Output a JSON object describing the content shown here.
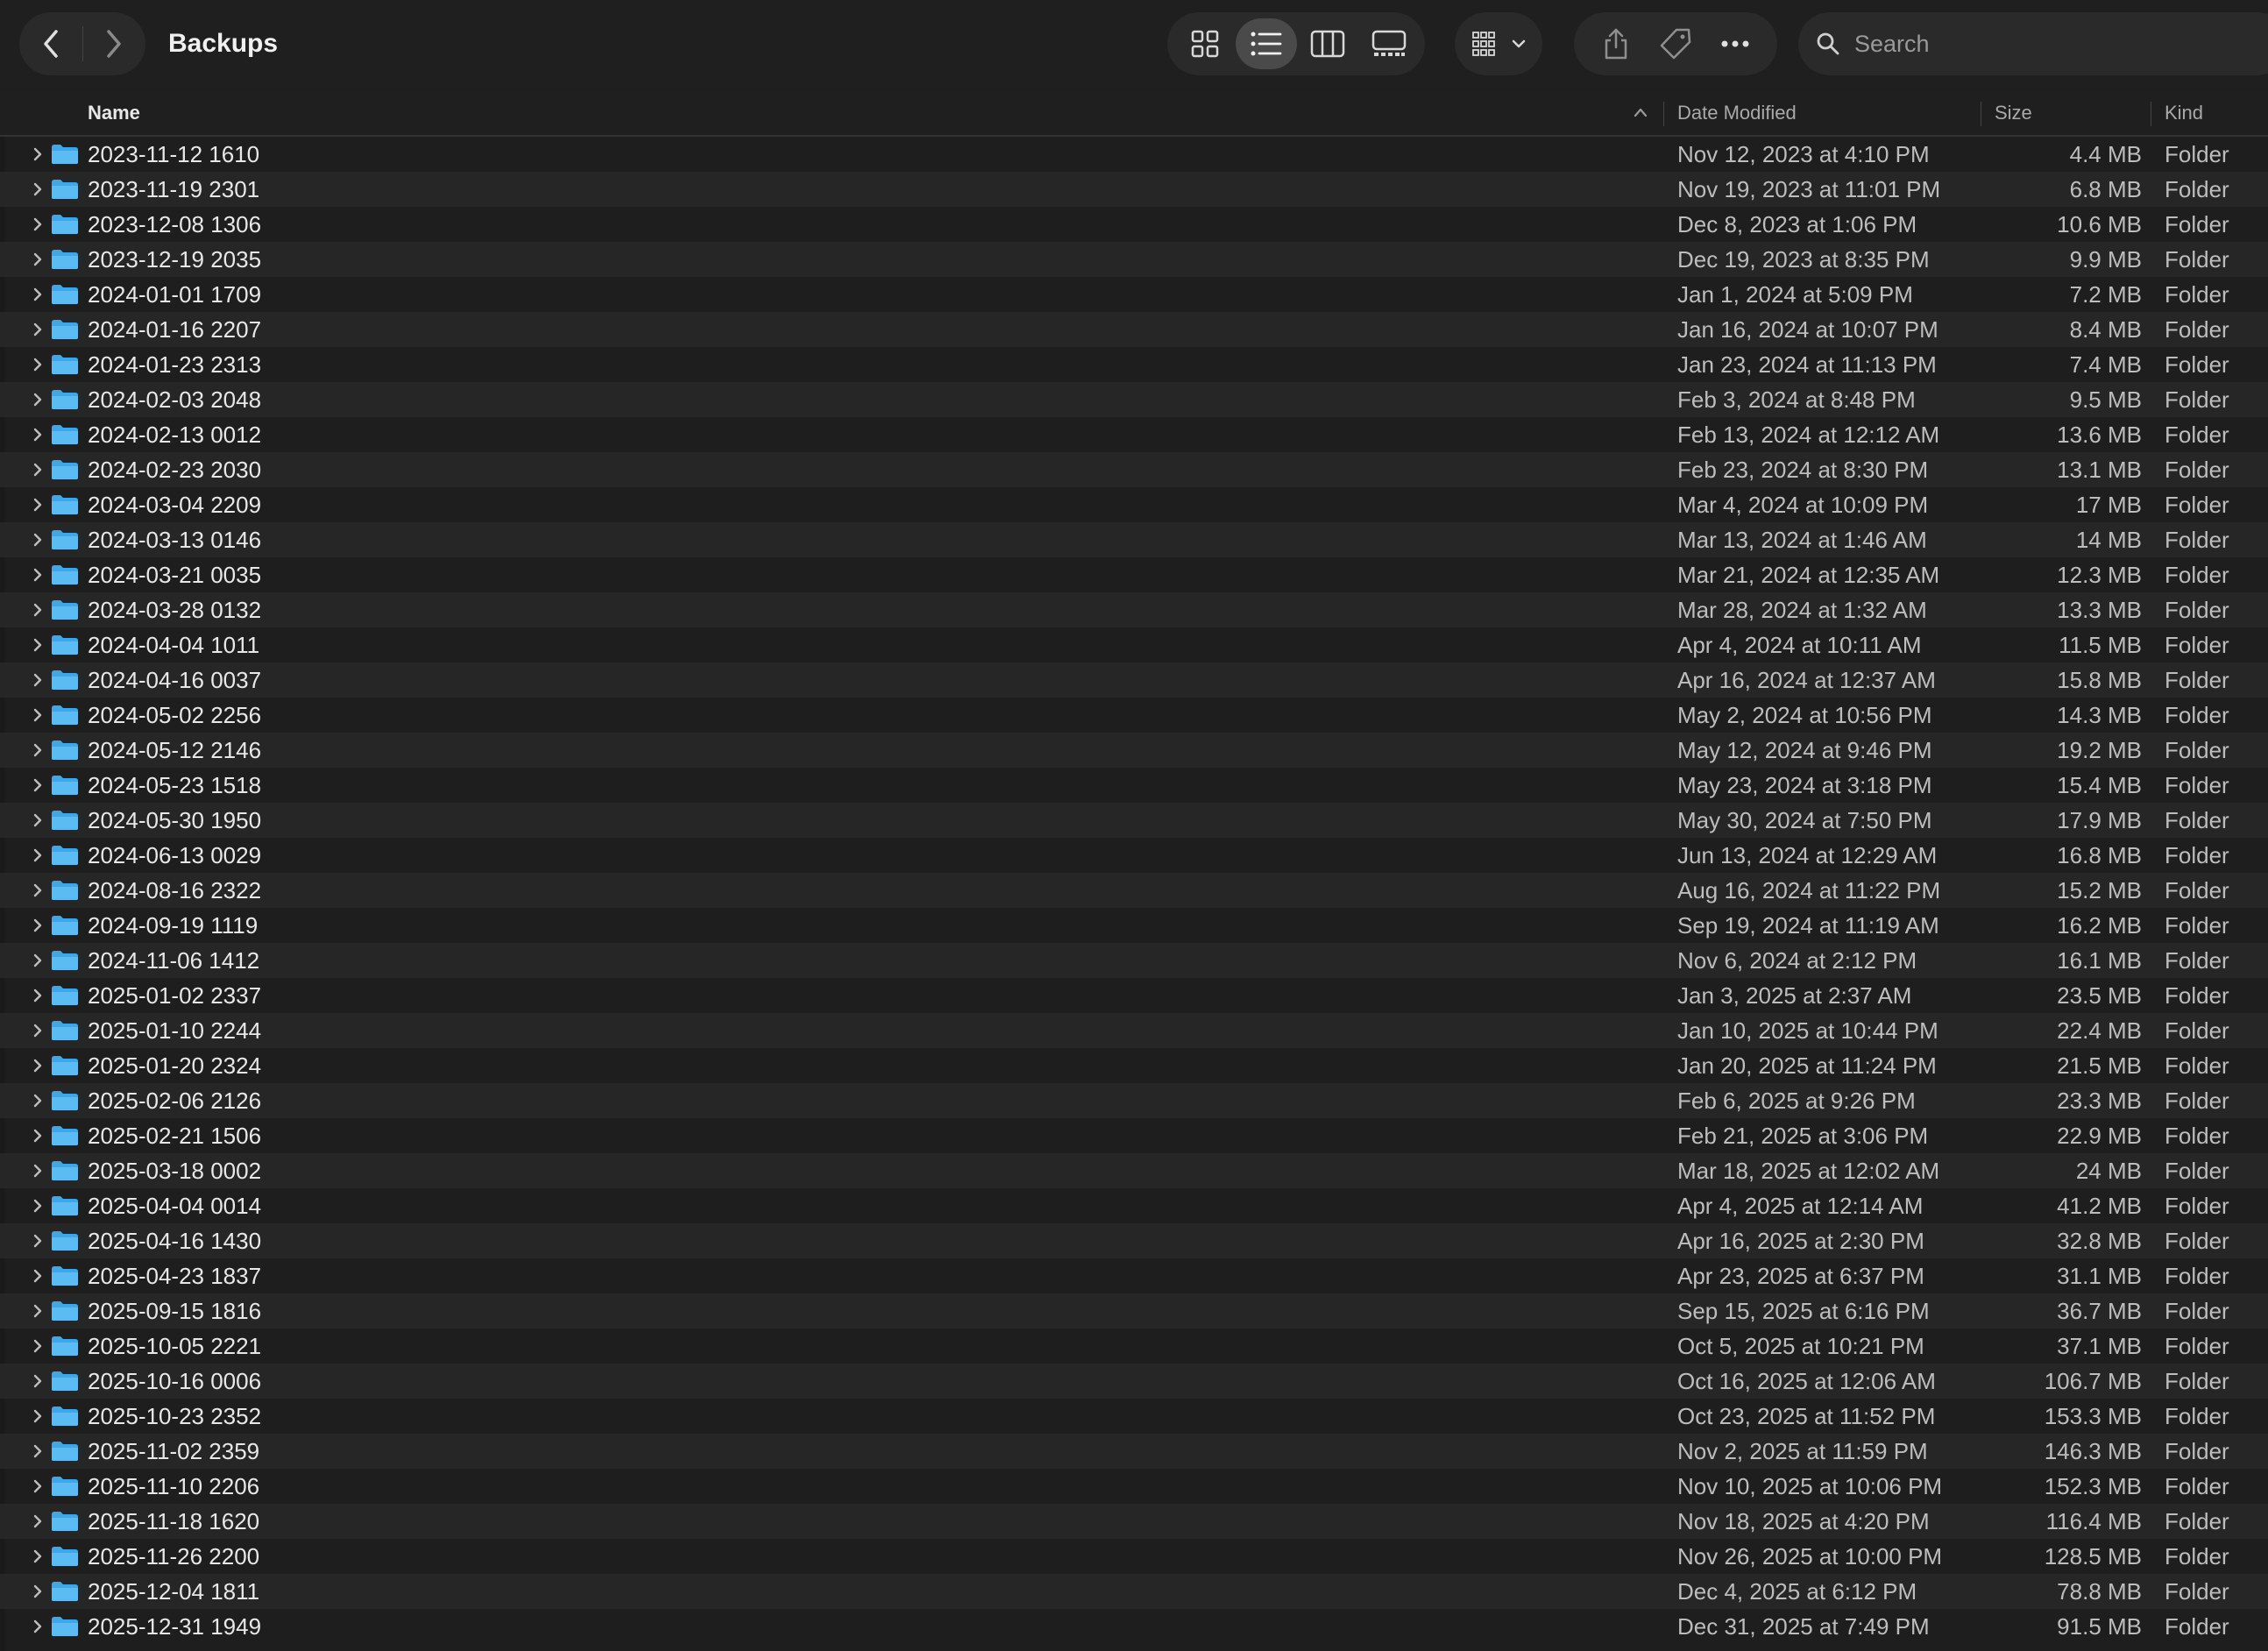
{
  "window": {
    "title": "Backups"
  },
  "toolbar": {
    "search_placeholder": "Search",
    "icons": {
      "back": "chevron-left-icon",
      "forward": "chevron-right-icon",
      "icon_view": "grid-icon",
      "list_view": "list-icon",
      "column_view": "columns-icon",
      "gallery_view": "gallery-icon",
      "group": "group-icon",
      "share": "share-icon",
      "tag": "tag-icon",
      "more": "ellipsis-icon",
      "search": "search-icon"
    },
    "active_view": "list"
  },
  "columns": {
    "name": "Name",
    "date": "Date Modified",
    "size": "Size",
    "kind": "Kind"
  },
  "colors": {
    "background": "#1e1e1e",
    "row_alt": "#262626",
    "folder": "#3ea7e8",
    "text": "#e8e8e8",
    "secondary_text": "#bdbdbd"
  },
  "rows": [
    {
      "name": "2023-11-12 1610",
      "date": "Nov 12, 2023 at 4:10 PM",
      "size": "4.4 MB",
      "kind": "Folder"
    },
    {
      "name": "2023-11-19 2301",
      "date": "Nov 19, 2023 at 11:01 PM",
      "size": "6.8 MB",
      "kind": "Folder"
    },
    {
      "name": "2023-12-08 1306",
      "date": "Dec 8, 2023 at 1:06 PM",
      "size": "10.6 MB",
      "kind": "Folder"
    },
    {
      "name": "2023-12-19 2035",
      "date": "Dec 19, 2023 at 8:35 PM",
      "size": "9.9 MB",
      "kind": "Folder"
    },
    {
      "name": "2024-01-01 1709",
      "date": "Jan 1, 2024 at 5:09 PM",
      "size": "7.2 MB",
      "kind": "Folder"
    },
    {
      "name": "2024-01-16 2207",
      "date": "Jan 16, 2024 at 10:07 PM",
      "size": "8.4 MB",
      "kind": "Folder"
    },
    {
      "name": "2024-01-23 2313",
      "date": "Jan 23, 2024 at 11:13 PM",
      "size": "7.4 MB",
      "kind": "Folder"
    },
    {
      "name": "2024-02-03 2048",
      "date": "Feb 3, 2024 at 8:48 PM",
      "size": "9.5 MB",
      "kind": "Folder"
    },
    {
      "name": "2024-02-13 0012",
      "date": "Feb 13, 2024 at 12:12 AM",
      "size": "13.6 MB",
      "kind": "Folder"
    },
    {
      "name": "2024-02-23 2030",
      "date": "Feb 23, 2024 at 8:30 PM",
      "size": "13.1 MB",
      "kind": "Folder"
    },
    {
      "name": "2024-03-04 2209",
      "date": "Mar 4, 2024 at 10:09 PM",
      "size": "17 MB",
      "kind": "Folder"
    },
    {
      "name": "2024-03-13 0146",
      "date": "Mar 13, 2024 at 1:46 AM",
      "size": "14 MB",
      "kind": "Folder"
    },
    {
      "name": "2024-03-21 0035",
      "date": "Mar 21, 2024 at 12:35 AM",
      "size": "12.3 MB",
      "kind": "Folder"
    },
    {
      "name": "2024-03-28 0132",
      "date": "Mar 28, 2024 at 1:32 AM",
      "size": "13.3 MB",
      "kind": "Folder"
    },
    {
      "name": "2024-04-04 1011",
      "date": "Apr 4, 2024 at 10:11 AM",
      "size": "11.5 MB",
      "kind": "Folder"
    },
    {
      "name": "2024-04-16 0037",
      "date": "Apr 16, 2024 at 12:37 AM",
      "size": "15.8 MB",
      "kind": "Folder"
    },
    {
      "name": "2024-05-02 2256",
      "date": "May 2, 2024 at 10:56 PM",
      "size": "14.3 MB",
      "kind": "Folder"
    },
    {
      "name": "2024-05-12 2146",
      "date": "May 12, 2024 at 9:46 PM",
      "size": "19.2 MB",
      "kind": "Folder"
    },
    {
      "name": "2024-05-23 1518",
      "date": "May 23, 2024 at 3:18 PM",
      "size": "15.4 MB",
      "kind": "Folder"
    },
    {
      "name": "2024-05-30 1950",
      "date": "May 30, 2024 at 7:50 PM",
      "size": "17.9 MB",
      "kind": "Folder"
    },
    {
      "name": "2024-06-13 0029",
      "date": "Jun 13, 2024 at 12:29 AM",
      "size": "16.8 MB",
      "kind": "Folder"
    },
    {
      "name": "2024-08-16 2322",
      "date": "Aug 16, 2024 at 11:22 PM",
      "size": "15.2 MB",
      "kind": "Folder"
    },
    {
      "name": "2024-09-19 1119",
      "date": "Sep 19, 2024 at 11:19 AM",
      "size": "16.2 MB",
      "kind": "Folder"
    },
    {
      "name": "2024-11-06 1412",
      "date": "Nov 6, 2024 at 2:12 PM",
      "size": "16.1 MB",
      "kind": "Folder"
    },
    {
      "name": "2025-01-02 2337",
      "date": "Jan 3, 2025 at 2:37 AM",
      "size": "23.5 MB",
      "kind": "Folder"
    },
    {
      "name": "2025-01-10 2244",
      "date": "Jan 10, 2025 at 10:44 PM",
      "size": "22.4 MB",
      "kind": "Folder"
    },
    {
      "name": "2025-01-20 2324",
      "date": "Jan 20, 2025 at 11:24 PM",
      "size": "21.5 MB",
      "kind": "Folder"
    },
    {
      "name": "2025-02-06 2126",
      "date": "Feb 6, 2025 at 9:26 PM",
      "size": "23.3 MB",
      "kind": "Folder"
    },
    {
      "name": "2025-02-21 1506",
      "date": "Feb 21, 2025 at 3:06 PM",
      "size": "22.9 MB",
      "kind": "Folder"
    },
    {
      "name": "2025-03-18 0002",
      "date": "Mar 18, 2025 at 12:02 AM",
      "size": "24 MB",
      "kind": "Folder"
    },
    {
      "name": "2025-04-04 0014",
      "date": "Apr 4, 2025 at 12:14 AM",
      "size": "41.2 MB",
      "kind": "Folder"
    },
    {
      "name": "2025-04-16 1430",
      "date": "Apr 16, 2025 at 2:30 PM",
      "size": "32.8 MB",
      "kind": "Folder"
    },
    {
      "name": "2025-04-23 1837",
      "date": "Apr 23, 2025 at 6:37 PM",
      "size": "31.1 MB",
      "kind": "Folder"
    },
    {
      "name": "2025-09-15 1816",
      "date": "Sep 15, 2025 at 6:16 PM",
      "size": "36.7 MB",
      "kind": "Folder"
    },
    {
      "name": "2025-10-05 2221",
      "date": "Oct 5, 2025 at 10:21 PM",
      "size": "37.1 MB",
      "kind": "Folder"
    },
    {
      "name": "2025-10-16 0006",
      "date": "Oct 16, 2025 at 12:06 AM",
      "size": "106.7 MB",
      "kind": "Folder"
    },
    {
      "name": "2025-10-23 2352",
      "date": "Oct 23, 2025 at 11:52 PM",
      "size": "153.3 MB",
      "kind": "Folder"
    },
    {
      "name": "2025-11-02 2359",
      "date": "Nov 2, 2025 at 11:59 PM",
      "size": "146.3 MB",
      "kind": "Folder"
    },
    {
      "name": "2025-11-10 2206",
      "date": "Nov 10, 2025 at 10:06 PM",
      "size": "152.3 MB",
      "kind": "Folder"
    },
    {
      "name": "2025-11-18 1620",
      "date": "Nov 18, 2025 at 4:20 PM",
      "size": "116.4 MB",
      "kind": "Folder"
    },
    {
      "name": "2025-11-26 2200",
      "date": "Nov 26, 2025 at 10:00 PM",
      "size": "128.5 MB",
      "kind": "Folder"
    },
    {
      "name": "2025-12-04 1811",
      "date": "Dec 4, 2025 at 6:12 PM",
      "size": "78.8 MB",
      "kind": "Folder"
    },
    {
      "name": "2025-12-31 1949",
      "date": "Dec 31, 2025 at 7:49 PM",
      "size": "91.5 MB",
      "kind": "Folder"
    }
  ]
}
